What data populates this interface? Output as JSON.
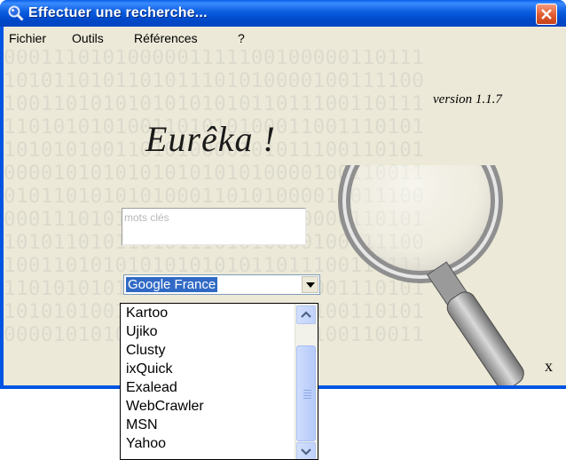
{
  "window": {
    "title": "Effectuer une recherche..."
  },
  "menu": {
    "items": [
      "Fichier",
      "Outils",
      "Références",
      "?"
    ]
  },
  "app": {
    "version": "version 1.1.7",
    "logo_text": "Eurêka !"
  },
  "search": {
    "placeholder": "mots clés"
  },
  "engine": {
    "selected": "Google France",
    "options": [
      "Kartoo",
      "Ujiko",
      "Clusty",
      "ixQuick",
      "Exalead",
      "WebCrawler",
      "MSN",
      "Yahoo"
    ]
  },
  "footer": {
    "corner_label": "x"
  },
  "background": {
    "binary_rows": [
      "0001110101000001111100100000110111",
      "1010110101101011101010000100111100",
      "1001101010101010101011011100110111",
      "1101010101001101010100011001110101",
      "1010101001101010000101011100110101",
      "0000101010101010101010000100110011",
      "0101101010101000110101000010011100",
      "0001110101010000001111100000110101",
      "1010110101101011101010000100111100",
      "1001101010101010101011011100110111",
      "1101010101001101010100011001110101",
      "1010101001101010000101011100110101",
      "0000101010101010101010000100110011"
    ]
  },
  "colors": {
    "titlebar": "#0054e3",
    "selection": "#316ac5",
    "close": "#e05a2d"
  },
  "icons": [
    "app-magnifier-icon",
    "close-icon",
    "dropdown-arrow-icon",
    "scroll-up-icon",
    "scroll-down-icon"
  ]
}
